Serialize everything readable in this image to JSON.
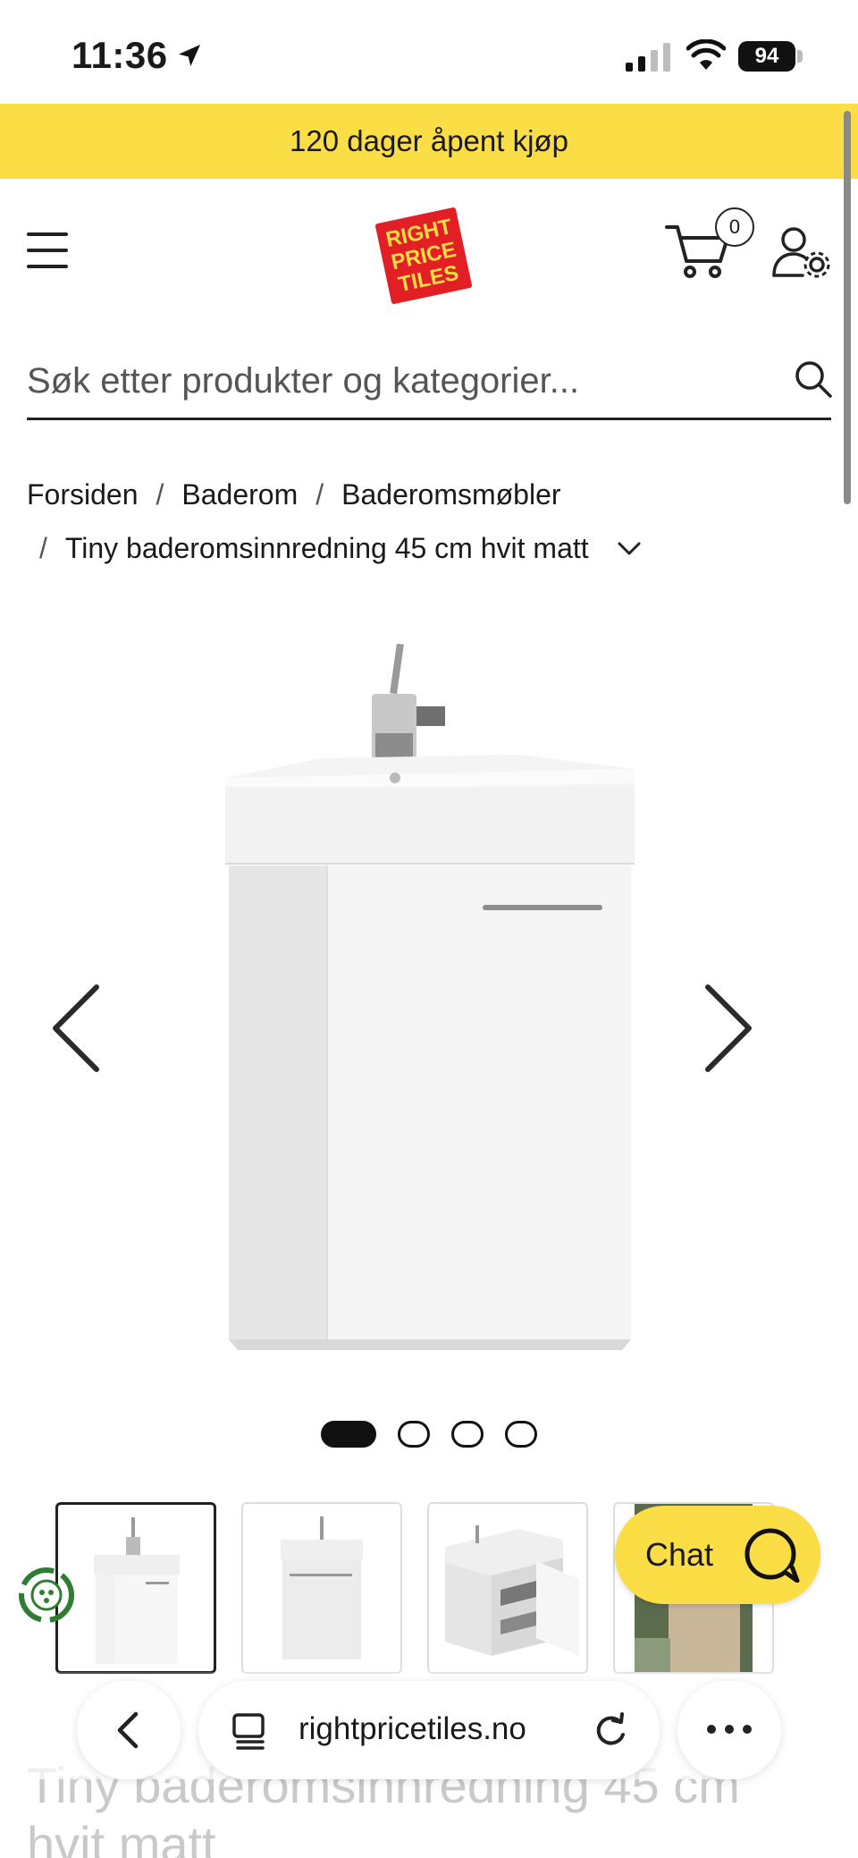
{
  "status_bar": {
    "time": "11:36",
    "battery": "94",
    "icons": [
      "location-arrow-icon",
      "cellular-signal-icon",
      "wifi-icon",
      "battery-icon"
    ]
  },
  "promo": {
    "text": "120 dager åpent kjøp"
  },
  "header": {
    "logo_text": [
      "RIGHT",
      "PRICE",
      "TILES"
    ],
    "cart_count": "0",
    "icons": [
      "menu-icon",
      "cart-icon",
      "account-settings-icon"
    ]
  },
  "search": {
    "placeholder": "Søk etter produkter og kategorier..."
  },
  "breadcrumb": {
    "items": [
      "Forsiden",
      "Baderom",
      "Baderomsmøbler",
      "Tiny baderomsinnredning 45 cm hvit matt"
    ],
    "separator": "/"
  },
  "gallery": {
    "slide_count": 4,
    "active_slide": 1,
    "thumbnail_count": 4
  },
  "chat": {
    "label": "Chat"
  },
  "product": {
    "title": "Tiny baderomsinnredning 45 cm hvit matt"
  },
  "browser": {
    "url": "rightpricetiles.no"
  },
  "colors": {
    "brand_yellow": "#fbdd45",
    "logo_red": "#e31f26",
    "text": "#1a1a1a"
  }
}
